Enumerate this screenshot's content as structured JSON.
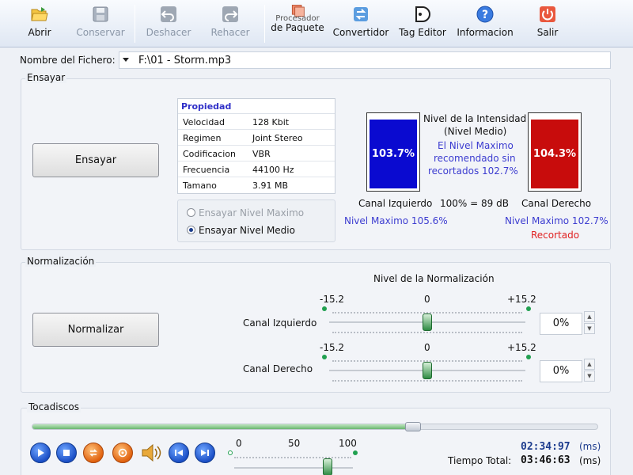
{
  "toolbar": {
    "open": "Abrir",
    "save": "Conservar",
    "undo": "Deshacer",
    "redo": "Rehacer",
    "batch_line1": "Procesador",
    "batch_line2": "de Paquete",
    "converter": "Convertidor",
    "tag_editor": "Tag Editor",
    "info": "Informacion",
    "exit": "Salir"
  },
  "file": {
    "label": "Nombre del Fichero:",
    "value": "F:\\01 - Storm.mp3"
  },
  "analyze": {
    "title": "Ensayar",
    "button": "Ensayar",
    "properties": {
      "header": "Propiedad",
      "rows": [
        {
          "key": "Velocidad",
          "value": "128 Kbit"
        },
        {
          "key": "Regimen",
          "value": "Joint Stereo"
        },
        {
          "key": "Codificacion",
          "value": "VBR"
        },
        {
          "key": "Frecuencia",
          "value": "44100 Hz"
        },
        {
          "key": "Tamano",
          "value": "3.91 MB"
        }
      ]
    },
    "radio_max": "Ensayar Nivel Maximo",
    "radio_avg": "Ensayar Nivel Medio",
    "intensity_title_1": "Nivel de la Intensidad",
    "intensity_title_2": "(Nivel Medio)",
    "recommend_1": "El Nivel Maximo",
    "recommend_2": "recomendado sin",
    "recommend_3": "recortados 102.7%",
    "left_meter_value": "103.7%",
    "right_meter_value": "104.3%",
    "left_channel_label": "Canal Izquierdo",
    "right_channel_label": "Canal Derecho",
    "db_ref": "100% = 89 dB",
    "left_max": "Nivel Maximo 105.6%",
    "right_max": "Nivel Maximo 102.7%",
    "clipped": "Recortado",
    "colors": {
      "left_meter": "#0a0ad0",
      "right_meter": "#d00a0a",
      "link_blue": "#3c3cd0",
      "clip_red": "#e02020"
    }
  },
  "normalize": {
    "title": "Normalización",
    "button": "Normalizar",
    "level_title": "Nivel de la Normalización",
    "min": "-15.2",
    "mid": "0",
    "max": "+15.2",
    "left_label": "Canal Izquierdo",
    "right_label": "Canal Derecho",
    "left_value": "0%",
    "right_value": "0%"
  },
  "player": {
    "title": "Tocadiscos",
    "progress": 0.67,
    "vol_min": "0",
    "vol_mid": "50",
    "vol_max": "100",
    "current_time": "02:34:97",
    "current_unit": "(ms)",
    "total_label": "Tiempo Total:",
    "total_time": "03:46:63",
    "total_unit": "(ms)"
  }
}
